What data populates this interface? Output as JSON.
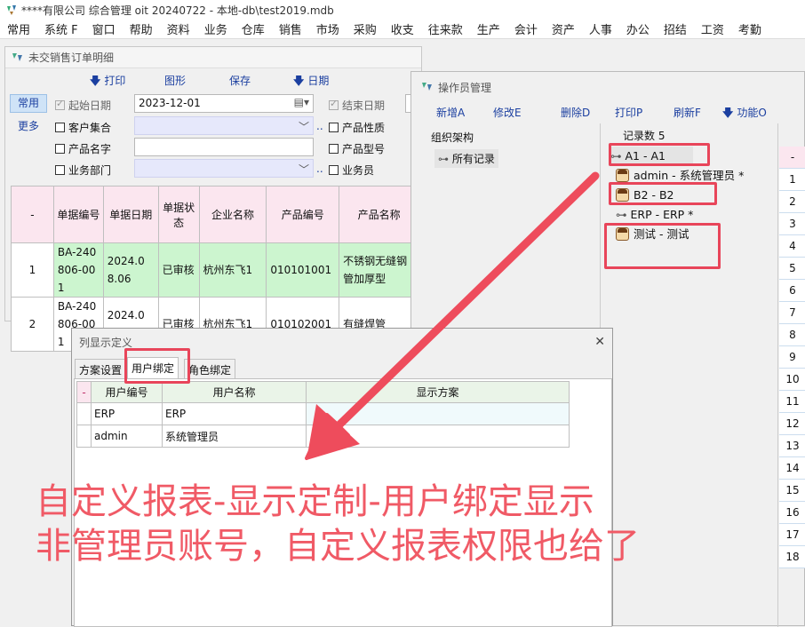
{
  "window_title": "****有限公司 综合管理 oit 20240722 - 本地-db\\test2019.mdb",
  "menu": [
    "常用",
    "系统 F",
    "窗口",
    "帮助",
    "资料",
    "业务",
    "仓库",
    "销售",
    "市场",
    "采购",
    "收支",
    "往来款",
    "生产",
    "会计",
    "资产",
    "人事",
    "办公",
    "招结",
    "工资",
    "考勤"
  ],
  "orders_window": {
    "title": "未交销售订单明细",
    "toolbar": {
      "print": "打印",
      "chart": "图形",
      "save": "保存",
      "date": "日期"
    },
    "side_tabs": {
      "common": "常用",
      "more": "更多"
    },
    "filters": {
      "start_date_label": "起始日期",
      "start_date_value": "2023-12-01",
      "end_date_label": "结束日期",
      "customer_set": "客户集合",
      "product_name": "产品名字",
      "department": "业务部门",
      "product_nature": "产品性质",
      "product_model": "产品型号",
      "salesperson": "业务员",
      "dots": ".."
    },
    "table": {
      "headers": [
        "-",
        "单据编号",
        "单据日期",
        "单据状态",
        "企业名称",
        "产品编号",
        "产品名称"
      ],
      "rows": [
        [
          "1",
          "BA-240806-001",
          "2024.08.06",
          "已审核",
          "杭州东飞1",
          "010101001",
          "不锈钢无缝钢管加厚型"
        ],
        [
          "2",
          "BA-240806-001",
          "2024.08.06",
          "已审核",
          "杭州东飞1",
          "010102001",
          "有缝焊管"
        ]
      ]
    }
  },
  "operator_window": {
    "title": "操作员管理",
    "toolbar": {
      "add": "新增A",
      "edit": "修改E",
      "delete": "删除D",
      "print": "打印P",
      "refresh": "刷新F",
      "functions": "功能O"
    },
    "org_label": "组织架构",
    "all_records": "所有记录",
    "record_count": "记录数 5",
    "users": [
      {
        "text": "A1 - A1",
        "selected": true
      },
      {
        "text": "admin - 系统管理员 *",
        "selected": false
      },
      {
        "text": "B2 - B2",
        "selected": false
      },
      {
        "text": "ERP - ERP *",
        "selected": false
      },
      {
        "text": "测试 - 测试",
        "selected": false
      }
    ],
    "row_numbers": [
      "-",
      "1",
      "2",
      "3",
      "4",
      "5",
      "6",
      "7",
      "8",
      "9",
      "10",
      "11",
      "12",
      "13",
      "14",
      "15",
      "16",
      "17",
      "18"
    ]
  },
  "column_dialog": {
    "title": "列显示定义",
    "close": "✕",
    "tabs": [
      "方案设置",
      "用户绑定",
      "角色绑定"
    ],
    "active_tab": "用户绑定",
    "headers": [
      "-",
      "用户编号",
      "用户名称",
      "显示方案"
    ],
    "rows": [
      [
        "ERP",
        "ERP",
        ""
      ],
      [
        "admin",
        "系统管理员",
        ""
      ]
    ]
  },
  "annotation": {
    "line1": "自定义报表-显示定制-用户绑定显示",
    "line2": "非管理员账号，自定义报表权限也给了"
  },
  "colors": {
    "annotation": "#e8455a",
    "grid_header": "#fbe6ef",
    "row_highlight": "#ccf5cf",
    "link_blue": "#1b3fa0"
  }
}
